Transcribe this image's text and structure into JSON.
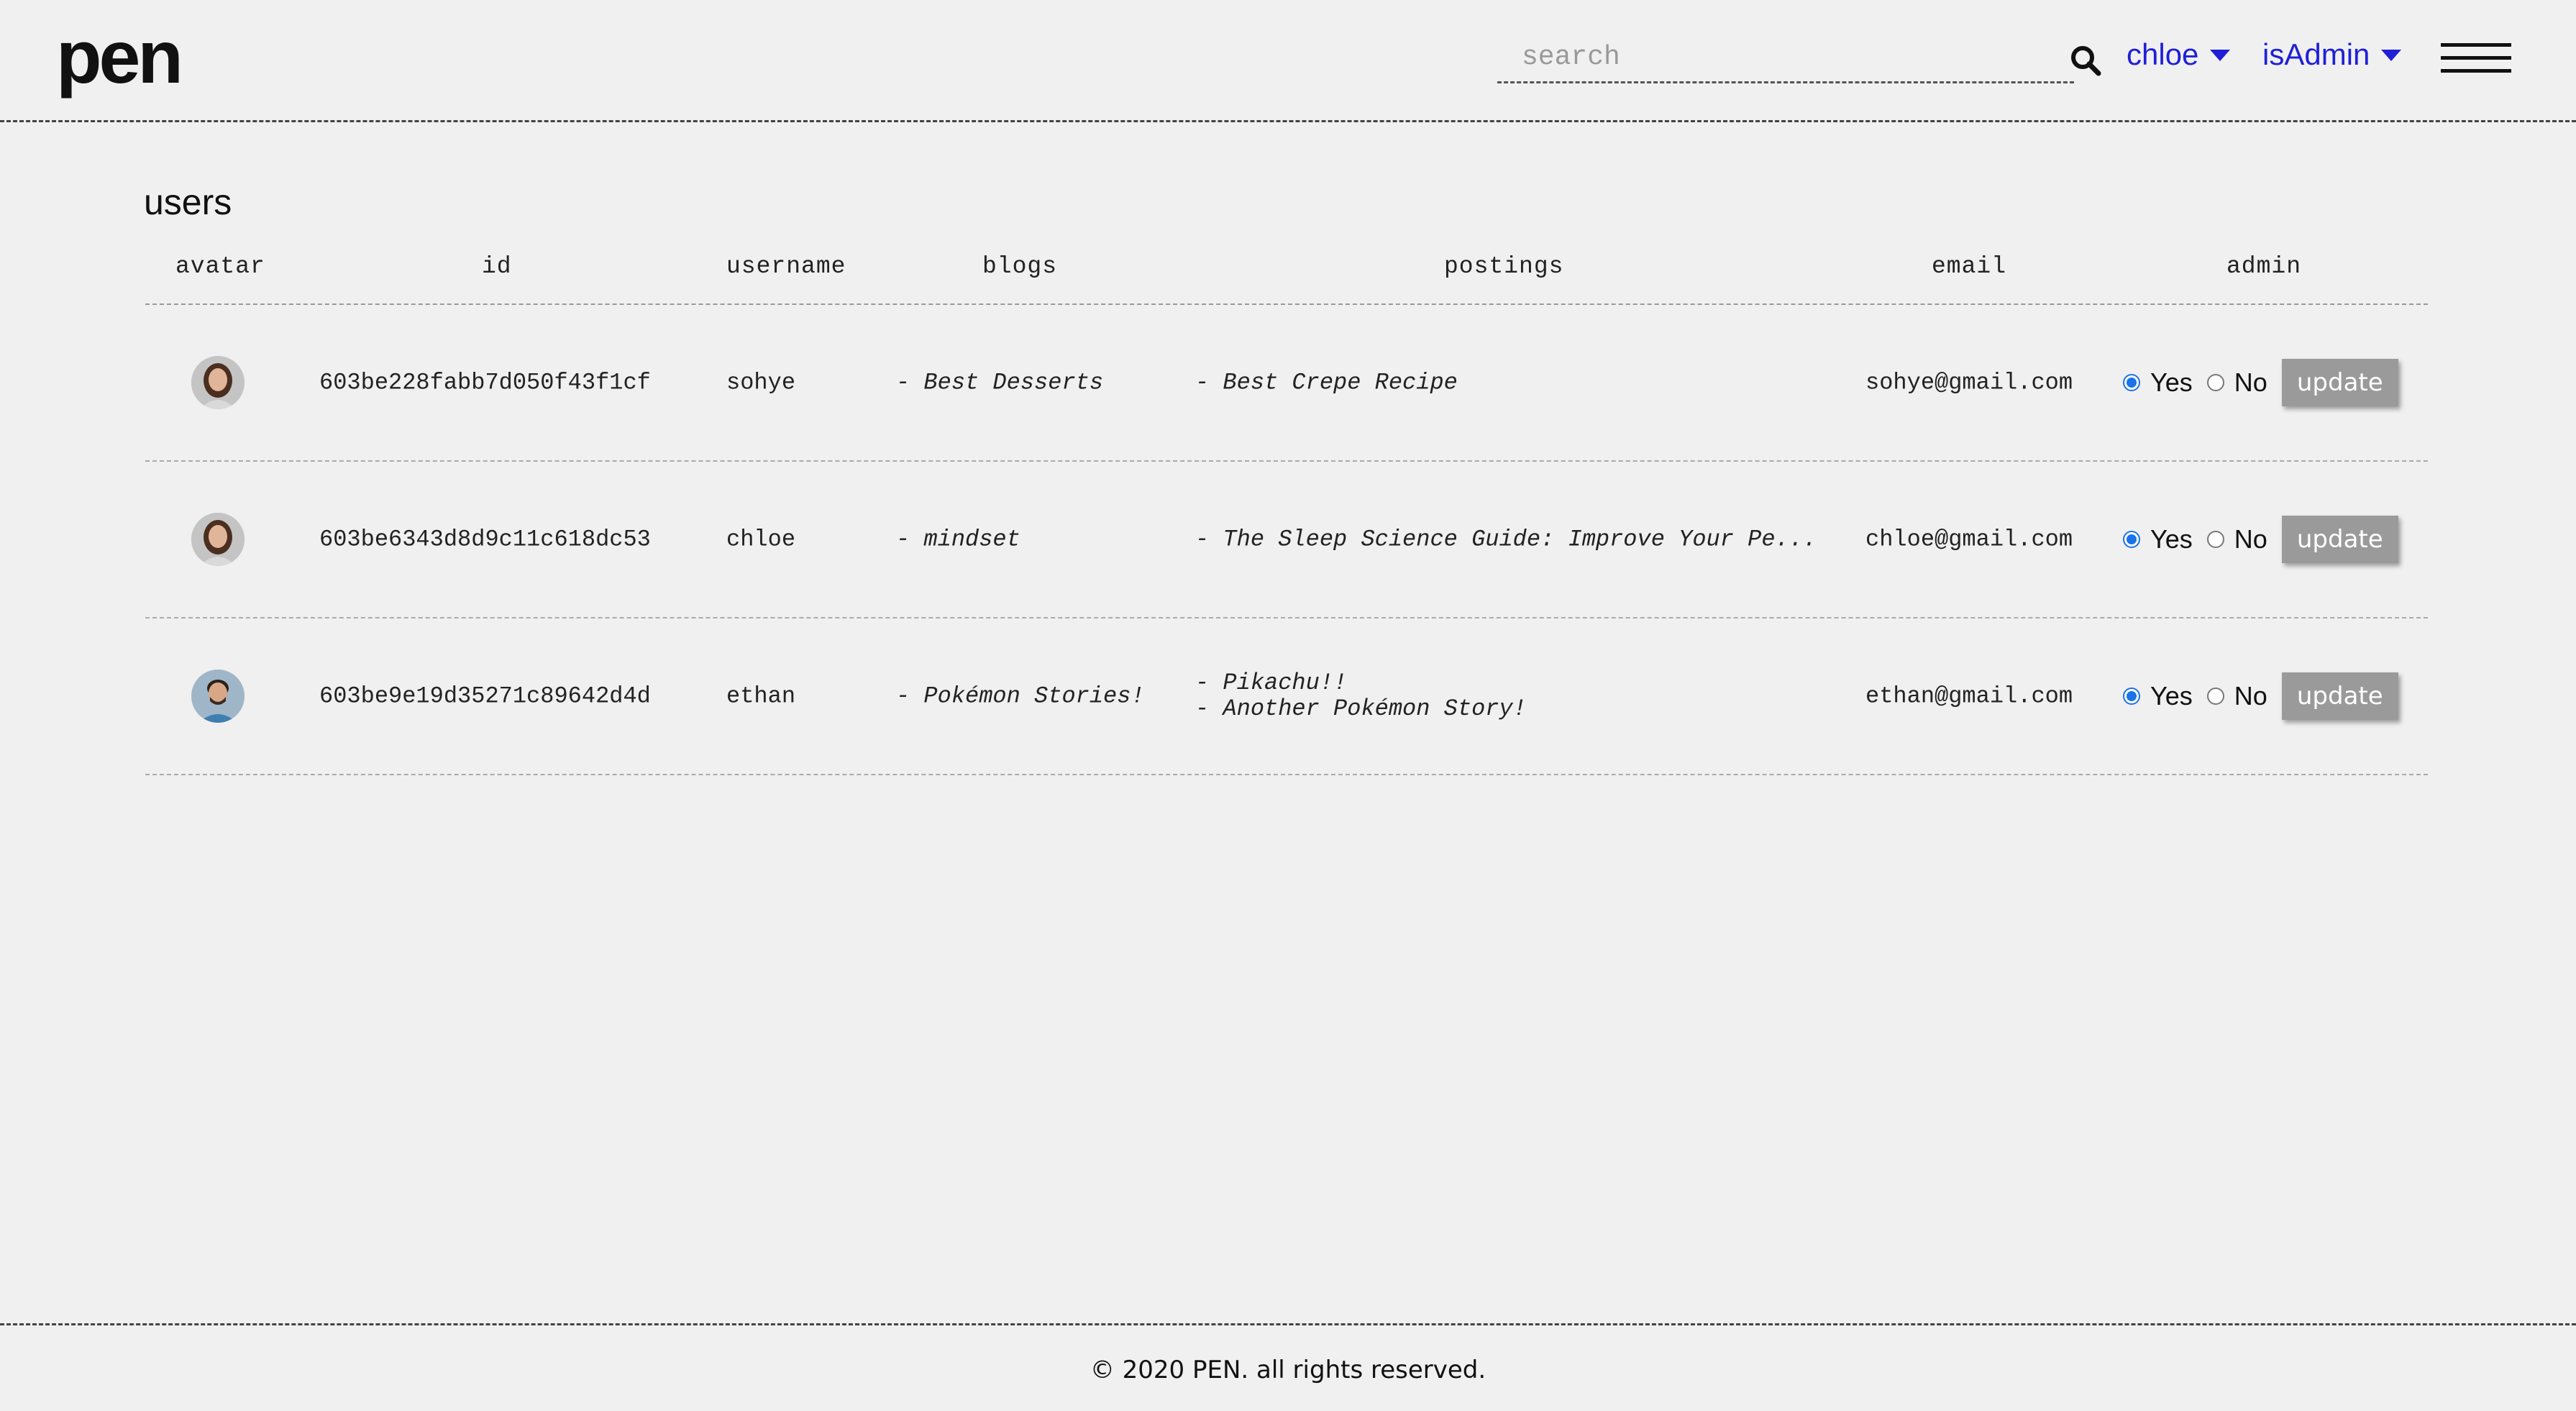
{
  "header": {
    "logo": "pen",
    "search": {
      "placeholder": "search",
      "value": ""
    },
    "user_menu_label": "chloe",
    "role_menu_label": "isAdmin"
  },
  "main": {
    "title": "users",
    "columns": [
      "avatar",
      "id",
      "username",
      "blogs",
      "postings",
      "email",
      "admin"
    ],
    "users": [
      {
        "id": "603be228fabb7d050f43f1cf",
        "username": "sohye",
        "blogs": [
          "- Best Desserts"
        ],
        "postings": [
          "- Best Crepe Recipe"
        ],
        "email": "sohye@gmail.com",
        "admin_yes": "Yes",
        "admin_no": "No",
        "admin_selected": "Yes",
        "update_label": "update",
        "avatar_icon": "woman-avatar"
      },
      {
        "id": "603be6343d8d9c11c618dc53",
        "username": "chloe",
        "blogs": [
          "- mindset"
        ],
        "postings": [
          "- The Sleep Science Guide: Improve Your Pe..."
        ],
        "email": "chloe@gmail.com",
        "admin_yes": "Yes",
        "admin_no": "No",
        "admin_selected": "Yes",
        "update_label": "update",
        "avatar_icon": "woman-avatar"
      },
      {
        "id": "603be9e19d35271c89642d4d",
        "username": "ethan",
        "blogs": [
          "- Pokémon Stories!"
        ],
        "postings": [
          "- Pikachu!!",
          "- Another Pokémon Story!"
        ],
        "email": "ethan@gmail.com",
        "admin_yes": "Yes",
        "admin_no": "No",
        "admin_selected": "Yes",
        "update_label": "update",
        "avatar_icon": "man-avatar"
      }
    ]
  },
  "footer": {
    "copyright": "© 2020 PEN. all rights reserved."
  },
  "colors": {
    "background": "#f0f0f0",
    "link_blue": "#1f1fd6",
    "radio_blue": "#1a73e8",
    "button_gray": "#9a9a9a"
  }
}
